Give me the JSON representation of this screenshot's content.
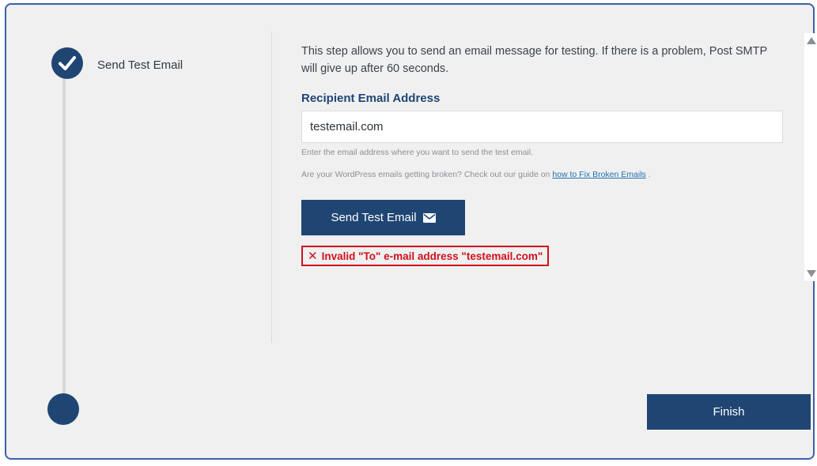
{
  "stepper": {
    "step_label": "Send Test Email",
    "done_icon": "checkmark-icon"
  },
  "content": {
    "description": "This step allows you to send an email message for testing. If there is a problem, Post SMTP will give up after 60 seconds.",
    "recipient_label": "Recipient Email Address",
    "recipient_value": "testemail.com",
    "hint": "Enter the email address where you want to send the test email.",
    "guide_prefix": "Are your WordPress emails getting broken? Check out our guide on",
    "guide_link": "how to Fix Broken Emails",
    "guide_suffix": ".",
    "send_button": "Send Test Email",
    "send_icon": "envelope-icon",
    "error_icon": "x-icon",
    "error_message": "Invalid \"To\" e-mail address \"testemail.com\""
  },
  "footer": {
    "finish_button": "Finish"
  },
  "colors": {
    "primary": "#1f4573",
    "error": "#d0111b",
    "link": "#2271b1",
    "panel_bg": "#f0f0f1",
    "frame_border": "#3c5fa8"
  }
}
